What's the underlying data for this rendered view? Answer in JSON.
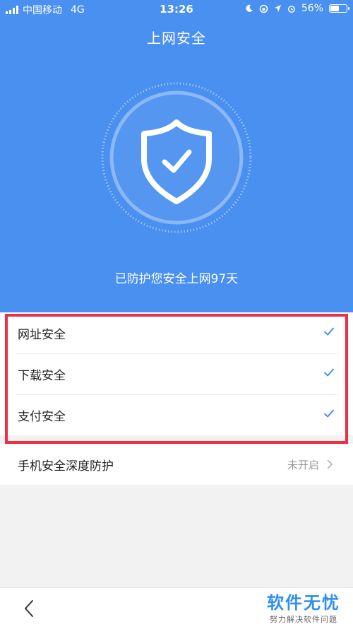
{
  "status_bar": {
    "carrier": "中国移动",
    "network": "4G",
    "time": "13:26",
    "battery": "56%",
    "battery_level": 0.56
  },
  "header": {
    "title": "上网安全",
    "protected_text": "已防护您安全上网97天"
  },
  "options": [
    {
      "label": "网址安全",
      "checked": true
    },
    {
      "label": "下载安全",
      "checked": true
    },
    {
      "label": "支付安全",
      "checked": true
    }
  ],
  "deep_protection": {
    "label": "手机安全深度防护",
    "status": "未开启"
  },
  "watermark": {
    "title": "软件无忧",
    "subtitle": "努力解决软件问题"
  },
  "colors": {
    "primary": "#4a90f0",
    "highlight": "#ec2f45",
    "check": "#3a86f0"
  }
}
